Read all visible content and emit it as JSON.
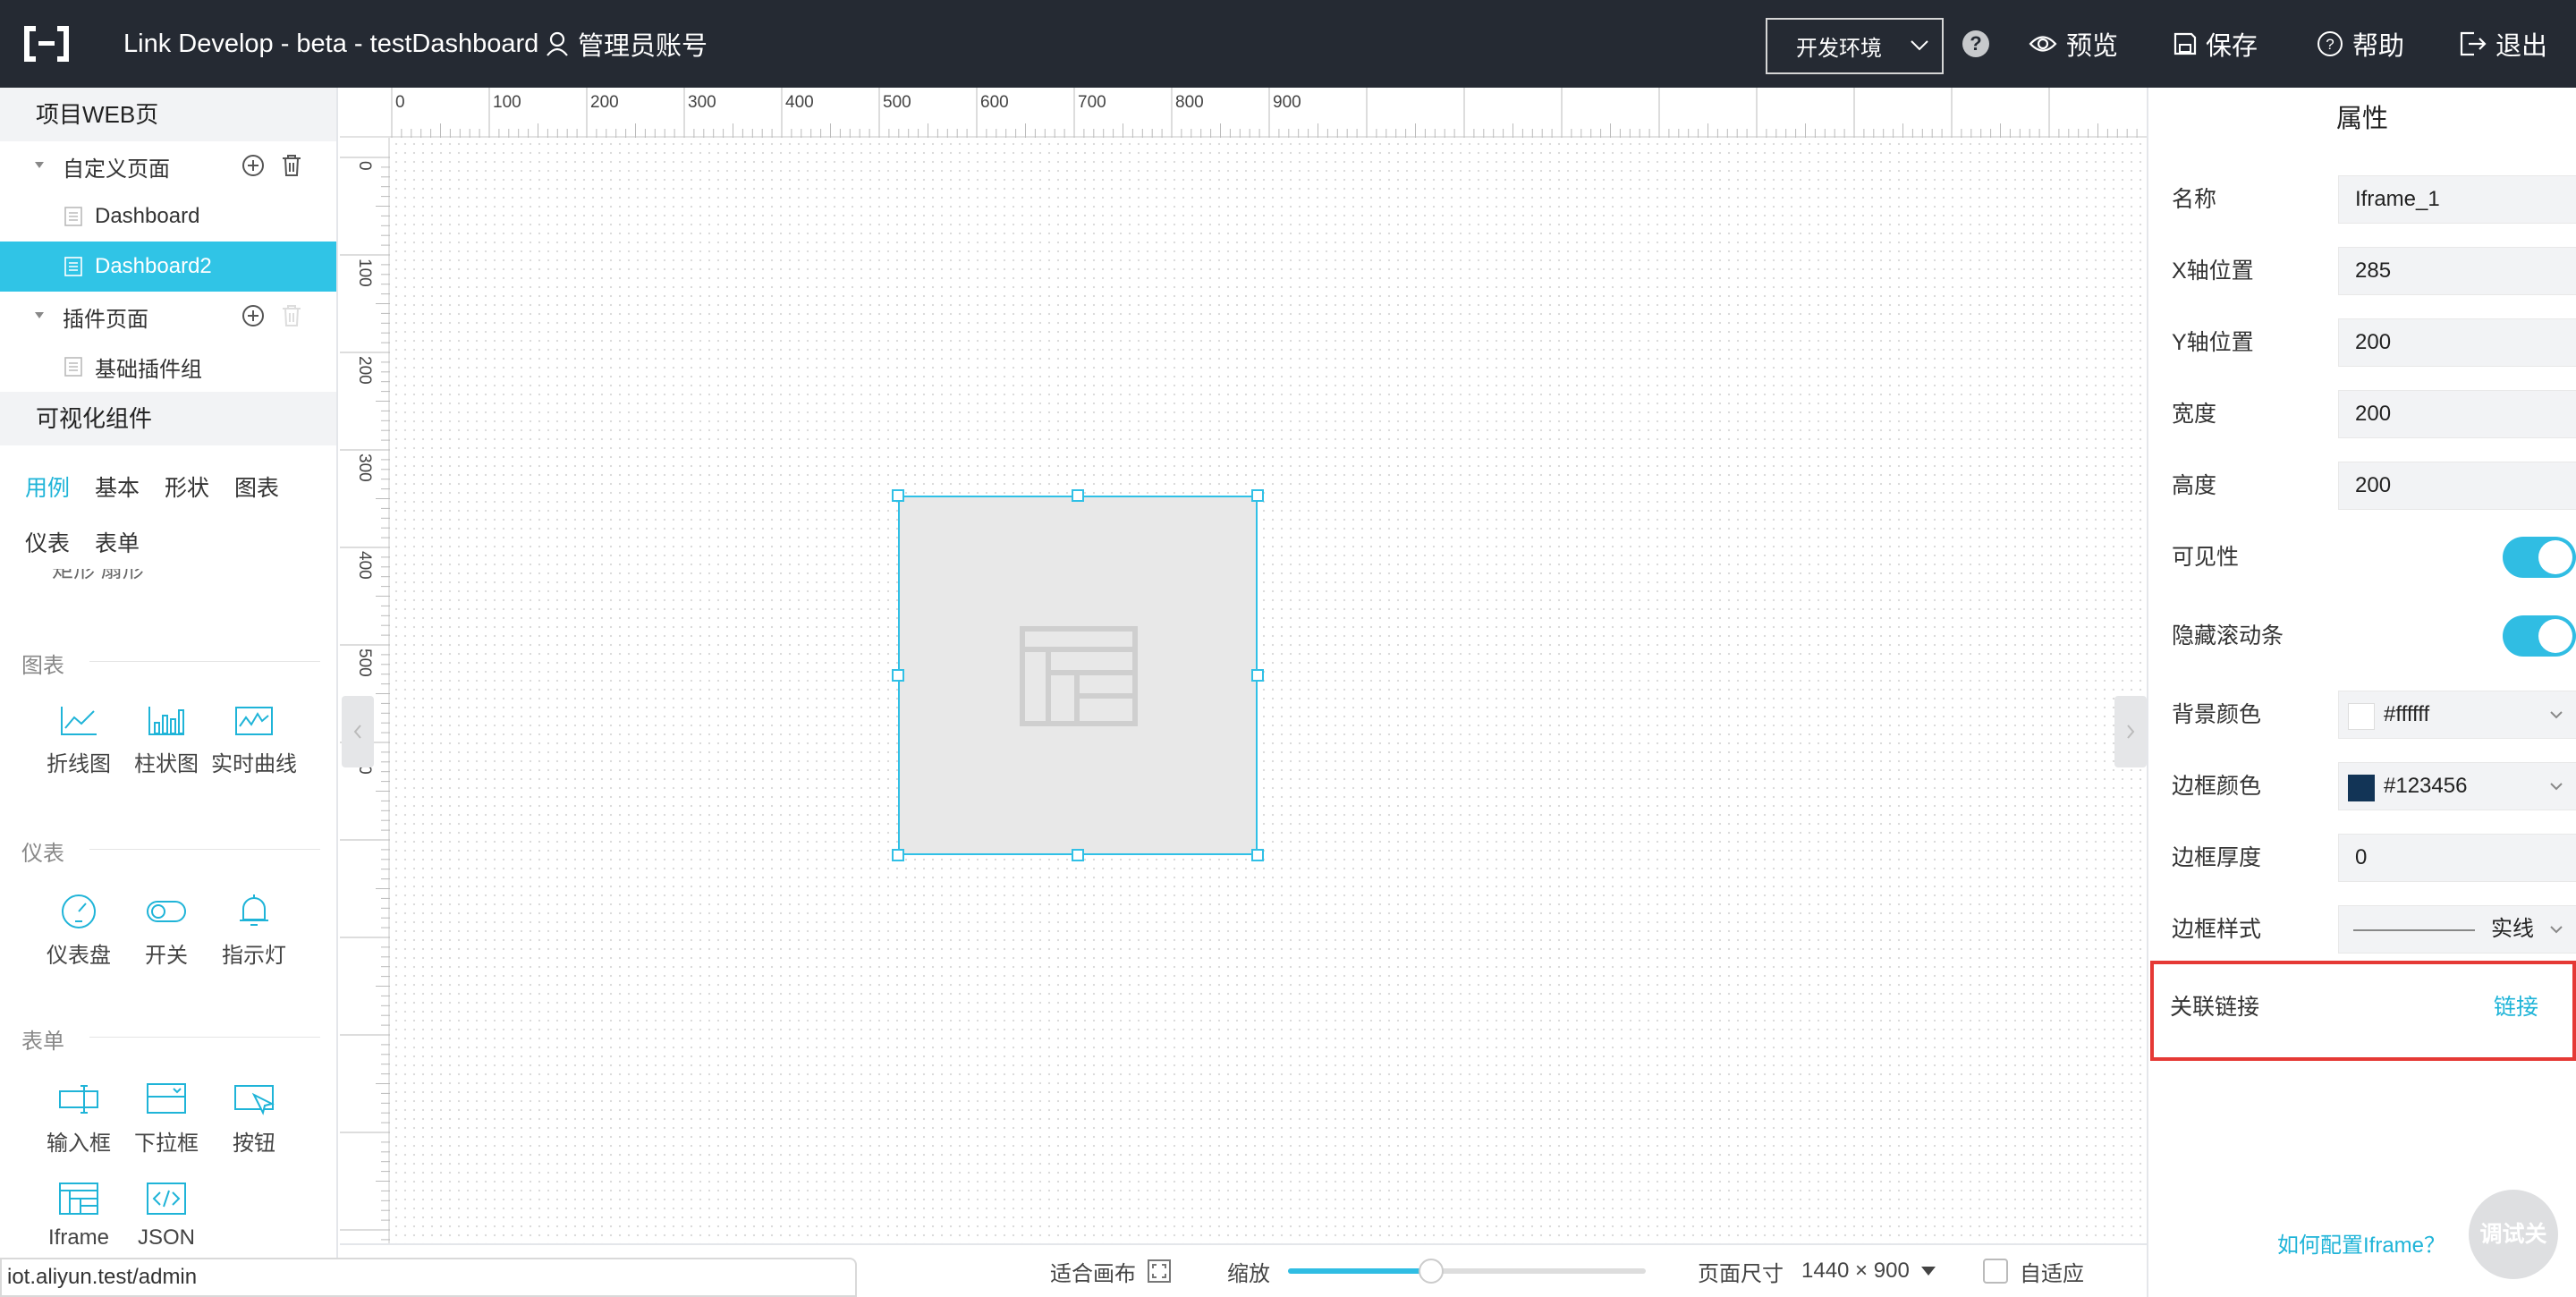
{
  "topbar": {
    "title": "Link Develop - beta - testDashboard",
    "admin_label": "管理员账号",
    "env_select": "开发环境",
    "help_icon_text": "?",
    "preview": "预览",
    "save": "保存",
    "help": "帮助",
    "logout": "退出"
  },
  "left": {
    "project_web": "项目WEB页",
    "custom_pages": "自定义页面",
    "pages": [
      "Dashboard",
      "Dashboard2"
    ],
    "plugin_pages": "插件页面",
    "plugin_group": "基础插件组",
    "visual_components": "可视化组件",
    "tabs": [
      "用例",
      "基本",
      "形状",
      "图表",
      "仪表",
      "表单"
    ],
    "active_tab": "用例",
    "clipped_text": "矩形 扇形",
    "groups": {
      "chart": {
        "label": "图表",
        "items": [
          "折线图",
          "柱状图",
          "实时曲线"
        ]
      },
      "gauge": {
        "label": "仪表",
        "items": [
          "仪表盘",
          "开关",
          "指示灯"
        ]
      },
      "form": {
        "label": "表单",
        "items": [
          "输入框",
          "下拉框",
          "按钮",
          "Iframe",
          "JSON"
        ]
      }
    }
  },
  "canvas": {
    "hruler_ticks": [
      "0",
      "100",
      "200",
      "300",
      "400",
      "500",
      "600",
      "700",
      "800",
      "900"
    ],
    "vruler_ticks": [
      "0",
      "100",
      "200",
      "300",
      "400",
      "500",
      "600"
    ]
  },
  "bottombar": {
    "fit_canvas": "适合画布",
    "zoom_label": "缩放",
    "zoom_level": 0.4,
    "page_size_label": "页面尺寸",
    "page_size_value": "1440 × 900",
    "adaptive": "自适应"
  },
  "status_url": "iot.aliyun.test/admin",
  "properties": {
    "title": "属性",
    "name": {
      "label": "名称",
      "value": "Iframe_1"
    },
    "x": {
      "label": "X轴位置",
      "value": "285"
    },
    "y": {
      "label": "Y轴位置",
      "value": "200"
    },
    "width": {
      "label": "宽度",
      "value": "200"
    },
    "height": {
      "label": "高度",
      "value": "200"
    },
    "visible": {
      "label": "可见性",
      "on": true
    },
    "hide_scroll": {
      "label": "隐藏滚动条",
      "on": true
    },
    "bg_color": {
      "label": "背景颜色",
      "value": "#ffffff"
    },
    "border_color": {
      "label": "边框颜色",
      "value": "#123456"
    },
    "border_width": {
      "label": "边框厚度",
      "value": "0"
    },
    "border_style": {
      "label": "边框样式",
      "value": "实线"
    },
    "link": {
      "label": "关联链接",
      "action": "链接"
    },
    "help_link": "如何配置Iframe？",
    "debug_button": "调试关"
  },
  "colors": {
    "accent": "#30c4e6",
    "topbar": "#252a33",
    "highlight_box": "#e53935"
  }
}
